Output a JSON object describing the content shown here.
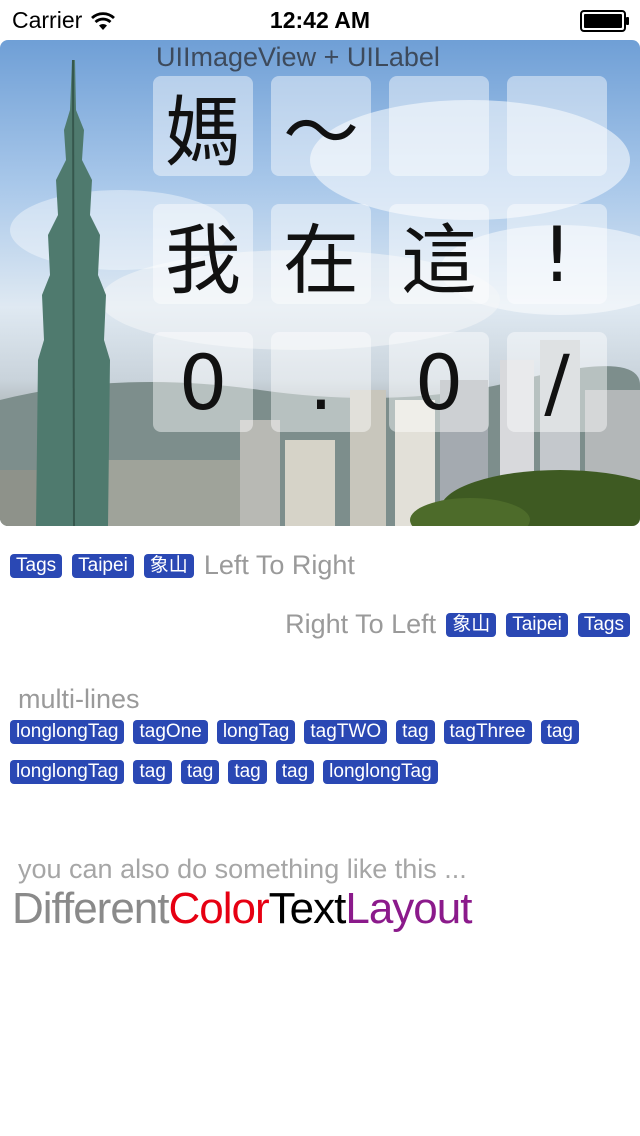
{
  "status_bar": {
    "carrier": "Carrier",
    "time": "12:42 AM"
  },
  "hero": {
    "caption": "UIImageView + UILabel",
    "glyphs": [
      "媽",
      "～",
      "",
      "",
      "我",
      "在",
      "這",
      "!",
      "0",
      ".",
      "0",
      "/"
    ]
  },
  "tags_ltr": {
    "tags": [
      "Tags",
      "Taipei",
      "象山"
    ],
    "label": "Left To Right"
  },
  "tags_rtl": {
    "label": "Right To Left",
    "tags": [
      "象山",
      "Taipei",
      "Tags"
    ]
  },
  "multiline": {
    "label": "multi-lines",
    "line1": [
      "longlongTag",
      "tagOne",
      "longTag",
      "tagTWO",
      "tag",
      "tagThree",
      "tag"
    ],
    "line2": [
      "longlongTag",
      "tag",
      "tag",
      "tag",
      "tag",
      "longlongTag"
    ]
  },
  "color_layout": {
    "hint": "you can also do something like this ...",
    "words": [
      {
        "text": "Different",
        "color": "#8a8a8a"
      },
      {
        "text": "Color",
        "color": "#e60012"
      },
      {
        "text": "Text",
        "color": "#000000"
      },
      {
        "text": "Layout",
        "color": "#8b1a8b"
      }
    ]
  },
  "colors": {
    "tag_bg": "#2a48b4",
    "tag_text": "#ffffff"
  }
}
